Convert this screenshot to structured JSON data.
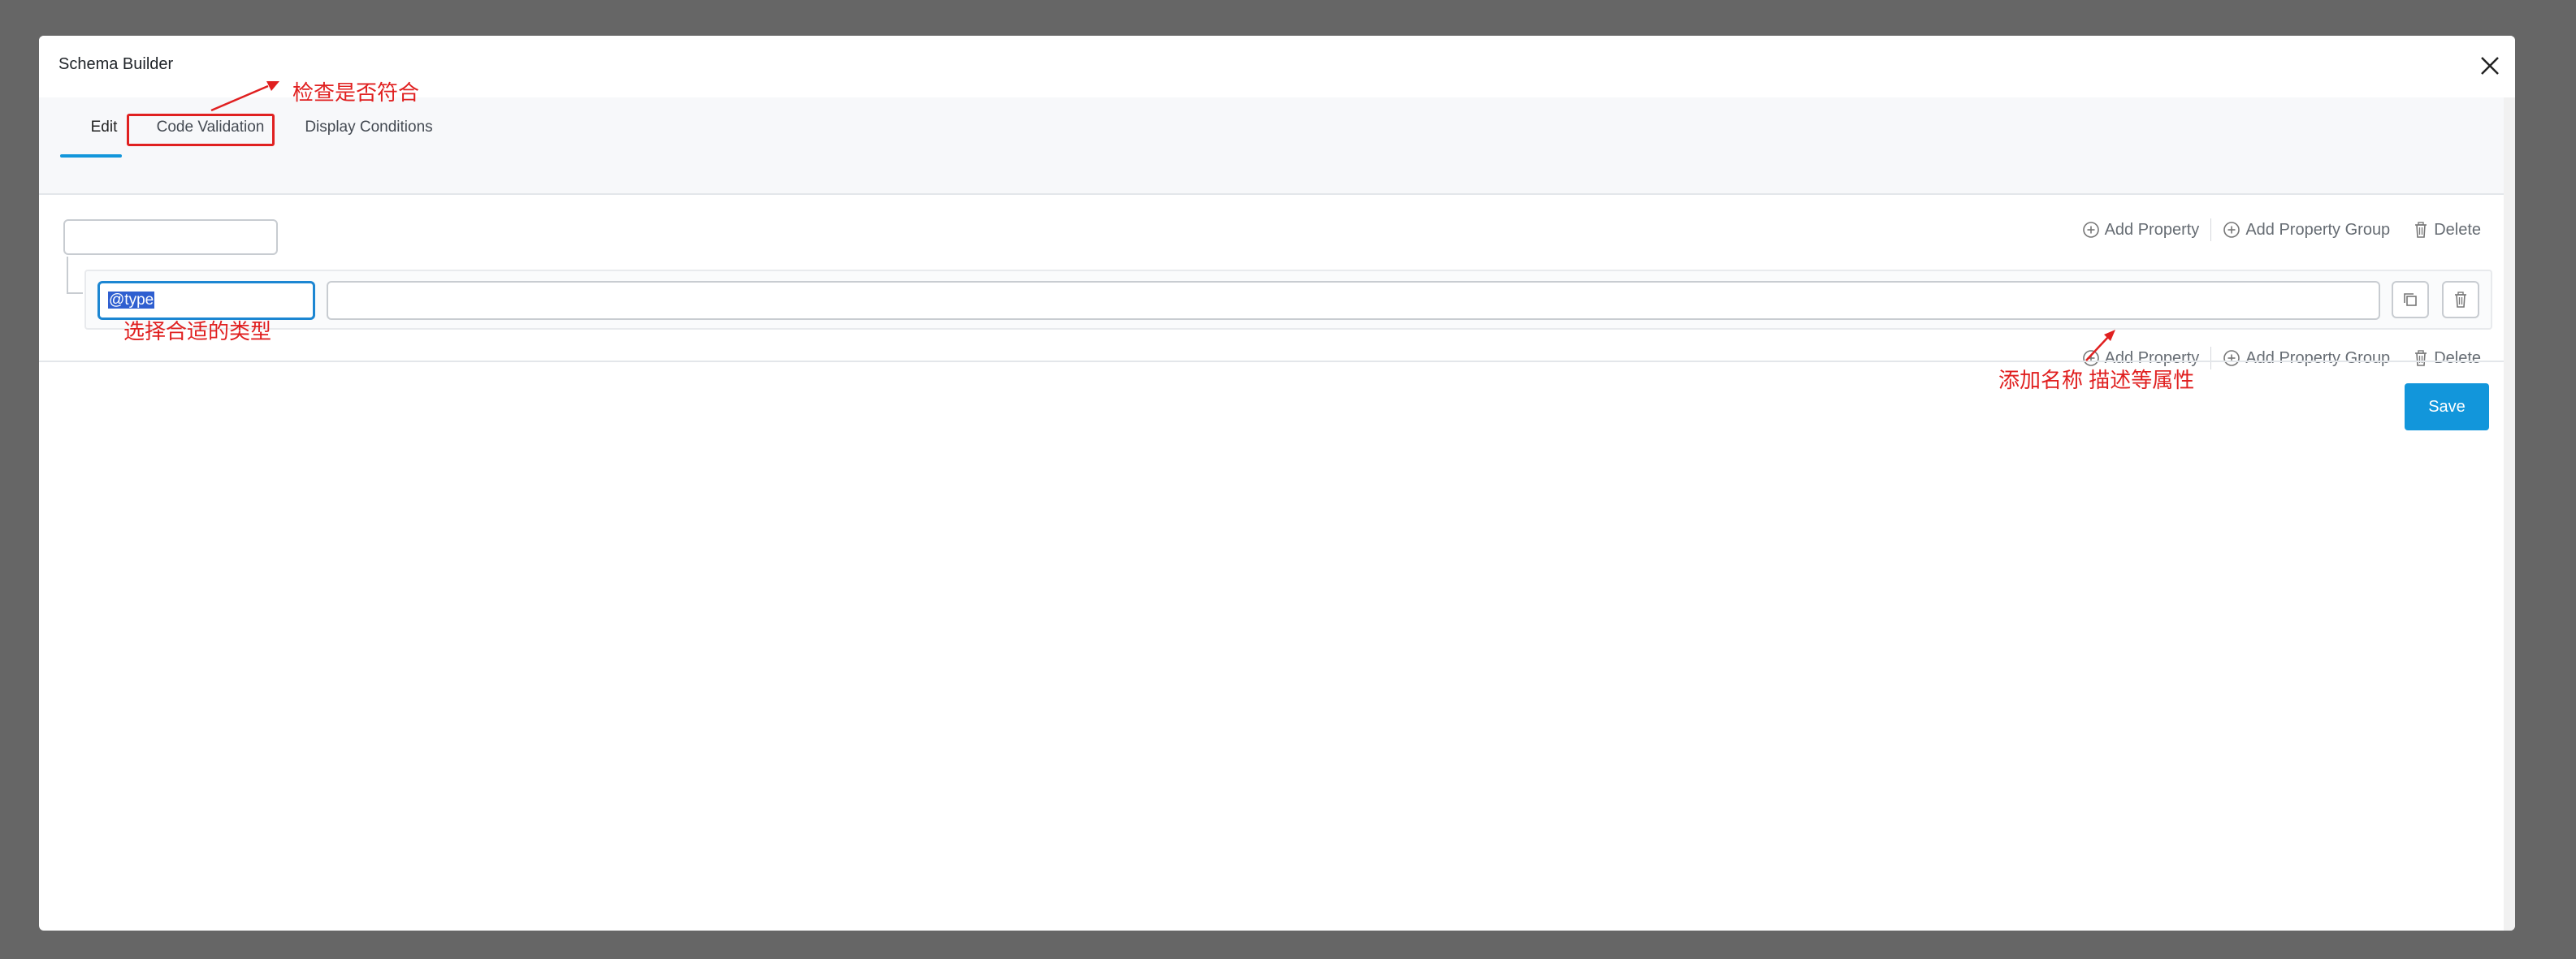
{
  "modal": {
    "title": "Schema Builder"
  },
  "tabs": [
    {
      "label": "Edit",
      "active": true
    },
    {
      "label": "Code Validation",
      "active": false
    },
    {
      "label": "Display Conditions",
      "active": false
    }
  ],
  "actions": {
    "add_property": "Add Property",
    "add_property_group": "Add Property Group",
    "delete": "Delete"
  },
  "property": {
    "key_value": "@type",
    "value": ""
  },
  "save_label": "Save",
  "annotations": {
    "check": "检查是否符合",
    "select_type": "选择合适的类型",
    "add_attrs": "添加名称 描述等属性"
  },
  "colors": {
    "accent": "#1296db",
    "annotation": "#e02020"
  },
  "icons": [
    "close-icon",
    "plus-circle-icon",
    "trash-icon",
    "copy-icon"
  ]
}
